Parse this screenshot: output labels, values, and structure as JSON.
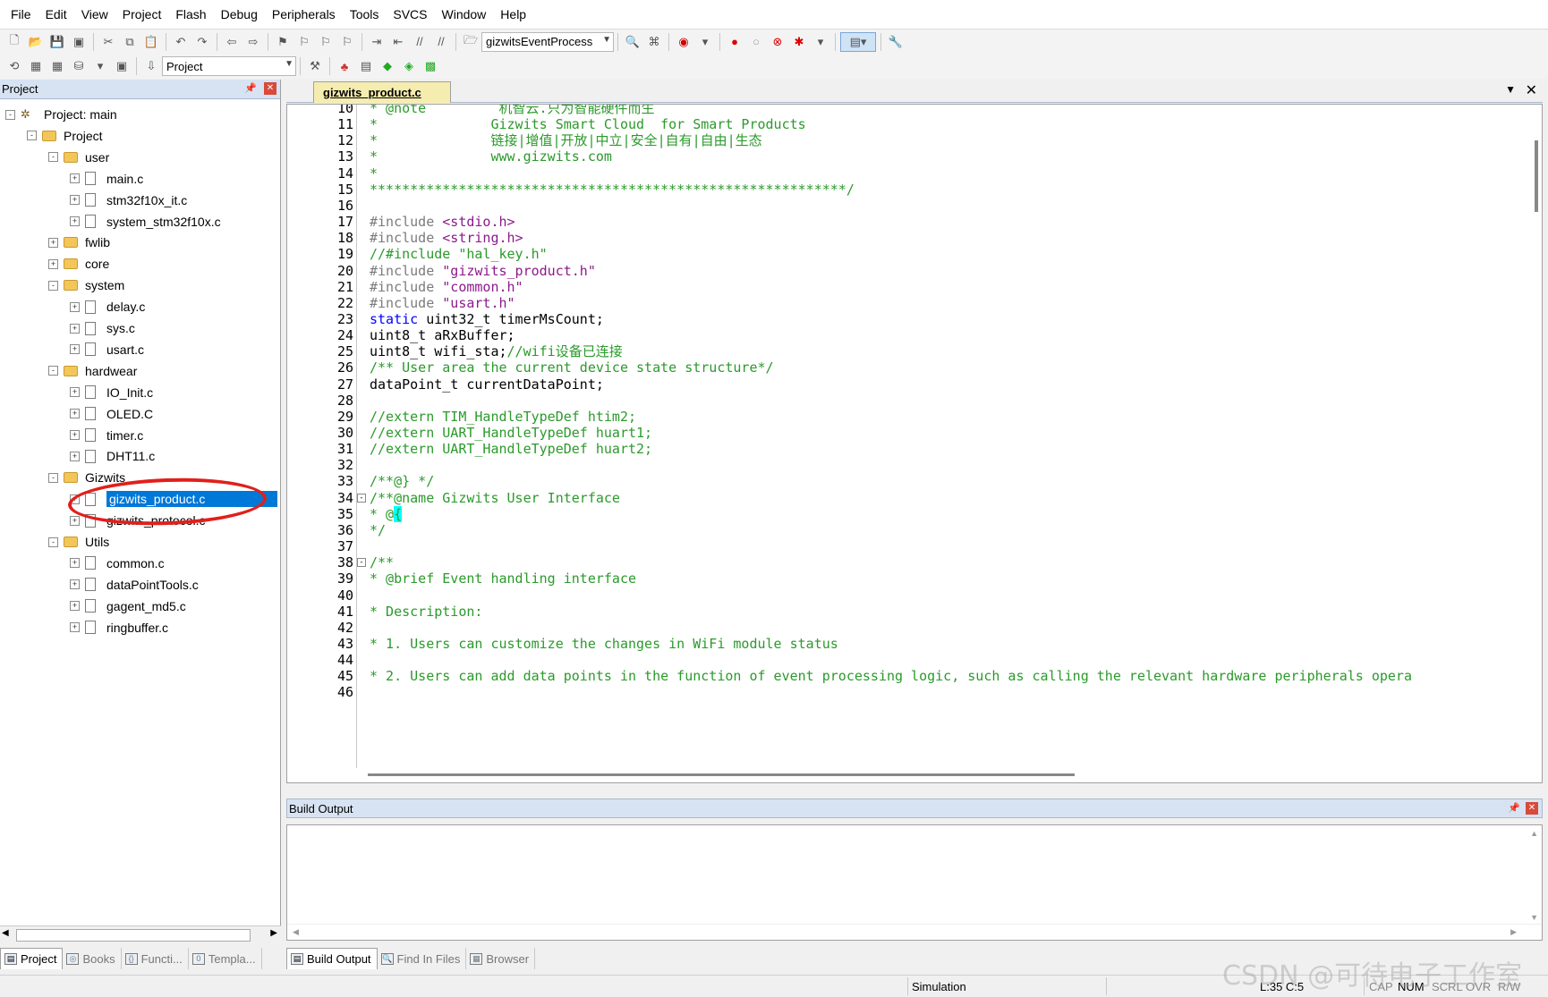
{
  "menu": [
    "File",
    "Edit",
    "View",
    "Project",
    "Flash",
    "Debug",
    "Peripherals",
    "Tools",
    "SVCS",
    "Window",
    "Help"
  ],
  "toolbar": {
    "target_combo": "gizwitsEventProcess",
    "project_combo": "Project"
  },
  "project_panel": {
    "title": "Project",
    "tree": [
      {
        "label": "Project: main",
        "type": "project",
        "level": 0,
        "expander": "-"
      },
      {
        "label": "Project",
        "type": "target",
        "level": 1,
        "expander": "-"
      },
      {
        "label": "user",
        "type": "folder",
        "level": 2,
        "expander": "-"
      },
      {
        "label": "main.c",
        "type": "file",
        "level": 3,
        "expander": "+"
      },
      {
        "label": "stm32f10x_it.c",
        "type": "file",
        "level": 3,
        "expander": "+"
      },
      {
        "label": "system_stm32f10x.c",
        "type": "file",
        "level": 3,
        "expander": "+"
      },
      {
        "label": "fwlib",
        "type": "folder",
        "level": 2,
        "expander": "+"
      },
      {
        "label": "core",
        "type": "folder",
        "level": 2,
        "expander": "+"
      },
      {
        "label": "system",
        "type": "folder",
        "level": 2,
        "expander": "-"
      },
      {
        "label": "delay.c",
        "type": "file",
        "level": 3,
        "expander": "+"
      },
      {
        "label": "sys.c",
        "type": "file",
        "level": 3,
        "expander": "+"
      },
      {
        "label": "usart.c",
        "type": "file",
        "level": 3,
        "expander": "+"
      },
      {
        "label": "hardwear",
        "type": "folder",
        "level": 2,
        "expander": "-"
      },
      {
        "label": "IO_Init.c",
        "type": "file",
        "level": 3,
        "expander": "+"
      },
      {
        "label": "OLED.C",
        "type": "file",
        "level": 3,
        "expander": "+"
      },
      {
        "label": "timer.c",
        "type": "file",
        "level": 3,
        "expander": "+"
      },
      {
        "label": "DHT11.c",
        "type": "file",
        "level": 3,
        "expander": "+"
      },
      {
        "label": "Gizwits",
        "type": "folder",
        "level": 2,
        "expander": "-"
      },
      {
        "label": "gizwits_product.c",
        "type": "file",
        "level": 3,
        "expander": "+",
        "selected": true
      },
      {
        "label": "gizwits_protocol.c",
        "type": "file",
        "level": 3,
        "expander": "+"
      },
      {
        "label": "Utils",
        "type": "folder",
        "level": 2,
        "expander": "-"
      },
      {
        "label": "common.c",
        "type": "file",
        "level": 3,
        "expander": "+"
      },
      {
        "label": "dataPointTools.c",
        "type": "file",
        "level": 3,
        "expander": "+"
      },
      {
        "label": "gagent_md5.c",
        "type": "file",
        "level": 3,
        "expander": "+"
      },
      {
        "label": "ringbuffer.c",
        "type": "file",
        "level": 3,
        "expander": "+"
      }
    ]
  },
  "editor": {
    "active_tab": "gizwits_product.c",
    "lines": [
      {
        "n": "10",
        "parts": [
          [
            "c",
            "* @note         机智云.只为智能硬件而生"
          ]
        ]
      },
      {
        "n": "11",
        "parts": [
          [
            "c",
            "*              Gizwits Smart Cloud  for Smart Products"
          ]
        ]
      },
      {
        "n": "12",
        "parts": [
          [
            "c",
            "*              链接|增值|开放|中立|安全|自有|自由|生态"
          ]
        ]
      },
      {
        "n": "13",
        "parts": [
          [
            "c",
            "*              www.gizwits.com"
          ]
        ]
      },
      {
        "n": "14",
        "parts": [
          [
            "c",
            "*"
          ]
        ]
      },
      {
        "n": "15",
        "parts": [
          [
            "c",
            "***********************************************************/"
          ]
        ]
      },
      {
        "n": "16",
        "parts": []
      },
      {
        "n": "17",
        "parts": [
          [
            "p",
            "#include "
          ],
          [
            "s",
            "<stdio.h>"
          ]
        ]
      },
      {
        "n": "18",
        "parts": [
          [
            "p",
            "#include "
          ],
          [
            "s",
            "<string.h>"
          ]
        ]
      },
      {
        "n": "19",
        "parts": [
          [
            "c",
            "//#include \"hal_key.h\""
          ]
        ]
      },
      {
        "n": "20",
        "parts": [
          [
            "p",
            "#include "
          ],
          [
            "s",
            "\"gizwits_product.h\""
          ]
        ]
      },
      {
        "n": "21",
        "parts": [
          [
            "p",
            "#include "
          ],
          [
            "s",
            "\"common.h\""
          ]
        ]
      },
      {
        "n": "22",
        "parts": [
          [
            "p",
            "#include "
          ],
          [
            "s",
            "\"usart.h\""
          ]
        ]
      },
      {
        "n": "23",
        "parts": [
          [
            "k",
            "static "
          ],
          [
            "n",
            "uint32_t timerMsCount;"
          ]
        ]
      },
      {
        "n": "24",
        "parts": [
          [
            "n",
            "uint8_t aRxBuffer;"
          ]
        ]
      },
      {
        "n": "25",
        "parts": [
          [
            "n",
            "uint8_t wifi_sta;"
          ],
          [
            "c",
            "//wifi设备已连接"
          ]
        ]
      },
      {
        "n": "26",
        "parts": [
          [
            "c",
            "/** User area the current device state structure*/"
          ]
        ]
      },
      {
        "n": "27",
        "parts": [
          [
            "n",
            "dataPoint_t currentDataPoint;"
          ]
        ]
      },
      {
        "n": "28",
        "parts": []
      },
      {
        "n": "29",
        "parts": [
          [
            "c",
            "//extern TIM_HandleTypeDef htim2;"
          ]
        ]
      },
      {
        "n": "30",
        "parts": [
          [
            "c",
            "//extern UART_HandleTypeDef huart1;"
          ]
        ]
      },
      {
        "n": "31",
        "parts": [
          [
            "c",
            "//extern UART_HandleTypeDef huart2;"
          ]
        ]
      },
      {
        "n": "32",
        "parts": []
      },
      {
        "n": "33",
        "parts": [
          [
            "c",
            "/**@} */"
          ]
        ]
      },
      {
        "n": "34",
        "fold": "-",
        "parts": [
          [
            "c",
            "/**@name Gizwits User Interface"
          ]
        ]
      },
      {
        "n": "35",
        "parts": [
          [
            "c",
            "* @"
          ],
          [
            "h",
            "{"
          ]
        ]
      },
      {
        "n": "36",
        "parts": [
          [
            "c",
            "*/"
          ]
        ]
      },
      {
        "n": "37",
        "parts": []
      },
      {
        "n": "38",
        "fold": "-",
        "parts": [
          [
            "c",
            "/**"
          ]
        ]
      },
      {
        "n": "39",
        "parts": [
          [
            "c",
            "* @brief Event handling interface"
          ]
        ]
      },
      {
        "n": "40",
        "parts": []
      },
      {
        "n": "41",
        "parts": [
          [
            "c",
            "* Description:"
          ]
        ]
      },
      {
        "n": "42",
        "parts": []
      },
      {
        "n": "43",
        "parts": [
          [
            "c",
            "* 1. Users can customize the changes in WiFi module status"
          ]
        ]
      },
      {
        "n": "44",
        "parts": []
      },
      {
        "n": "45",
        "parts": [
          [
            "c",
            "* 2. Users can add data points in the function of event processing logic, such as calling the relevant hardware peripherals opera"
          ]
        ]
      },
      {
        "n": "46",
        "parts": []
      }
    ]
  },
  "build_output": {
    "title": "Build Output"
  },
  "left_bottom_tabs": [
    "Project",
    "Books",
    "Functi...",
    "Templa..."
  ],
  "right_bottom_tabs": [
    "Build Output",
    "Find In Files",
    "Browser"
  ],
  "status": {
    "mode": "Simulation",
    "position": "L:35 C:5",
    "cap": "CAP",
    "num": "NUM",
    "scrl": "SCRL",
    "ovr": "OVR",
    "rw": "R/W"
  },
  "watermark": "CSDN @可待电子工作室",
  "colors": {
    "comment": "#2b9a2b",
    "preprocessor": "#7b7b7b",
    "string": "#8b1a8b",
    "keyword": "#0000ff",
    "selection": "#0078d7",
    "annotation_ellipse": "#e0201c",
    "tab_active": "#f5ecb0"
  }
}
